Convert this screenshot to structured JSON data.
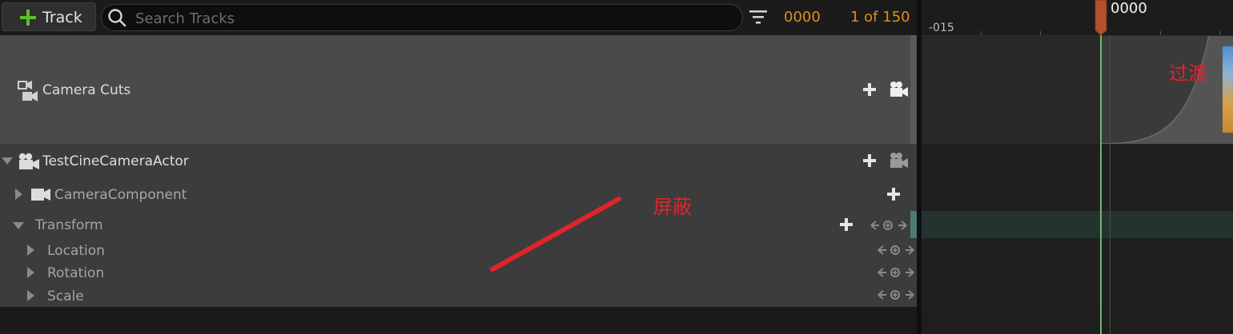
{
  "toolbar": {
    "add_track_label": "Track",
    "search_placeholder": "Search Tracks",
    "frame_number": "0000",
    "track_count": "1 of 150"
  },
  "timeline": {
    "tick_label": "-015",
    "playhead_frame": "0000",
    "section_label": "过渡"
  },
  "tracks": {
    "camera_cuts": "Camera Cuts",
    "actor": "TestCineCameraActor",
    "camera_component": "CameraComponent",
    "transform": "Transform",
    "location": "Location",
    "rotation": "Rotation",
    "scale": "Scale"
  },
  "annotation": {
    "mask_label": "屏蔽"
  },
  "colors": {
    "accent_orange": "#e08c1e",
    "add_green": "#58c22a",
    "playhead": "#6dbb6a",
    "annotation_red": "#e0242b"
  }
}
